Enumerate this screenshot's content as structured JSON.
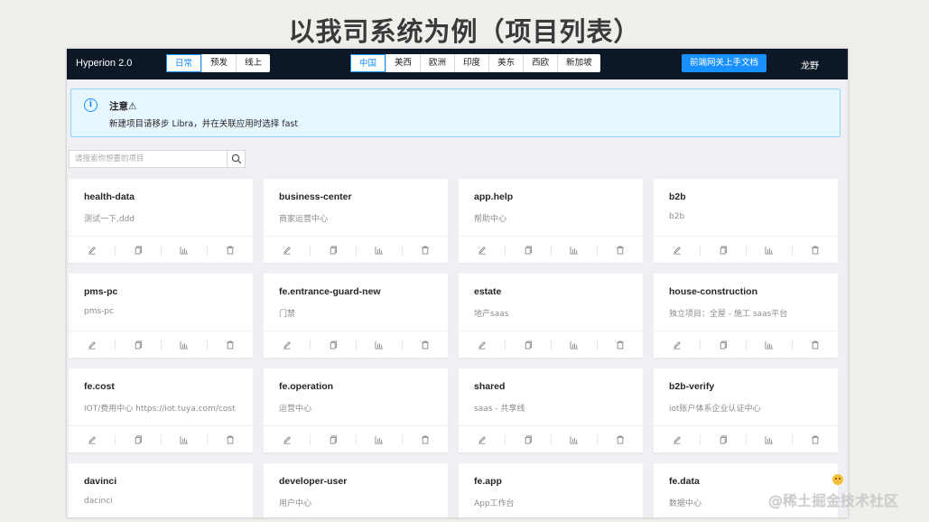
{
  "slide_title": "以我司系统为例（项目列表）",
  "app": {
    "brand": "Hyperion 2.0",
    "env_tabs": [
      {
        "label": "日常",
        "active": true
      },
      {
        "label": "预发",
        "active": false
      },
      {
        "label": "线上",
        "active": false
      }
    ],
    "region_tabs": [
      {
        "label": "中国",
        "active": true
      },
      {
        "label": "美西",
        "active": false
      },
      {
        "label": "欧洲",
        "active": false
      },
      {
        "label": "印度",
        "active": false
      },
      {
        "label": "美东",
        "active": false
      },
      {
        "label": "西欧",
        "active": false
      },
      {
        "label": "新加坡",
        "active": false
      }
    ],
    "doc_button": "前端网关上手文档",
    "user_name": "龙野"
  },
  "alert": {
    "icon": "info-icon",
    "title": "注意⚠",
    "description": "新建项目请移步 Libra，并在关联应用时选择 fast"
  },
  "search": {
    "placeholder": "请搜索你想要的项目",
    "value": ""
  },
  "card_actions": [
    "edit-icon",
    "copy-icon",
    "chart-icon",
    "delete-icon"
  ],
  "projects": [
    {
      "name": "health-data",
      "desc": "测试一下,ddd"
    },
    {
      "name": "business-center",
      "desc": "商家运营中心"
    },
    {
      "name": "app.help",
      "desc": "帮助中心"
    },
    {
      "name": "b2b",
      "desc": "b2b"
    },
    {
      "name": "pms-pc",
      "desc": "pms-pc"
    },
    {
      "name": "fe.entrance-guard-new",
      "desc": "门禁"
    },
    {
      "name": "estate",
      "desc": "地产saas"
    },
    {
      "name": "house-construction",
      "desc": "独立项目：全屋 - 施工 saas平台"
    },
    {
      "name": "fe.cost",
      "desc": "IOT/费用中心 https://iot.tuya.com/cost"
    },
    {
      "name": "fe.operation",
      "desc": "运营中心"
    },
    {
      "name": "shared",
      "desc": "saas - 共享线"
    },
    {
      "name": "b2b-verify",
      "desc": "iot账户体系企业认证中心"
    },
    {
      "name": "davinci",
      "desc": "dacinci"
    },
    {
      "name": "developer-user",
      "desc": "用户中心"
    },
    {
      "name": "fe.app",
      "desc": "App工作台"
    },
    {
      "name": "fe.data",
      "desc": "数据中心"
    }
  ],
  "watermark": "@稀土掘金技术社区"
}
